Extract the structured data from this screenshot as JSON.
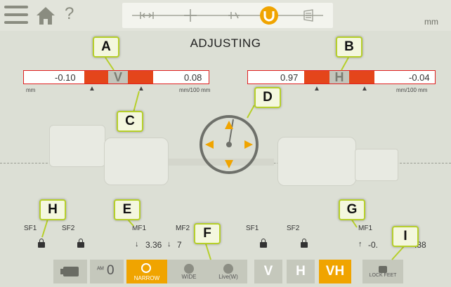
{
  "header": {
    "help": "?",
    "unit": "mm",
    "title": "ADJUSTING",
    "steps": [
      "measure-distances-icon",
      "sensor-setup-icon",
      "measure-icon",
      "adjust-magnet-icon",
      "report-icon"
    ],
    "active_step": 3
  },
  "vertical": {
    "angle_value": "-0.10",
    "offset_value": "0.08",
    "label": "V",
    "unit_left": "mm",
    "unit_right": "mm/100 mm"
  },
  "horizontal": {
    "angle_value": "0.97",
    "offset_value": "-0.04",
    "label": "H",
    "unit_right": "mm/100 mm"
  },
  "callouts": [
    "A",
    "B",
    "C",
    "D",
    "E",
    "F",
    "G",
    "H",
    "I"
  ],
  "feet_left": {
    "sf1": "SF1",
    "sf2": "SF2",
    "mf1": "MF1",
    "mf2": "MF2",
    "mf1_value": "3.36",
    "mf2_value": "7"
  },
  "feet_right": {
    "sf1": "SF1",
    "sf2": "SF2",
    "mf1": "MF1",
    "mf1_value": "-0.",
    "mf2_value": ".88"
  },
  "toolbar": {
    "thermal_zero": "0",
    "narrow": "NARROW",
    "wide": "WIDE",
    "live_wide": "Live(W)",
    "v": "V",
    "h": "H",
    "vh": "VH",
    "lock_feet": "LOCK FEET"
  },
  "colors": {
    "accent": "#f0a400",
    "alert": "#e4451b",
    "callout_border": "#b6cf2a"
  }
}
